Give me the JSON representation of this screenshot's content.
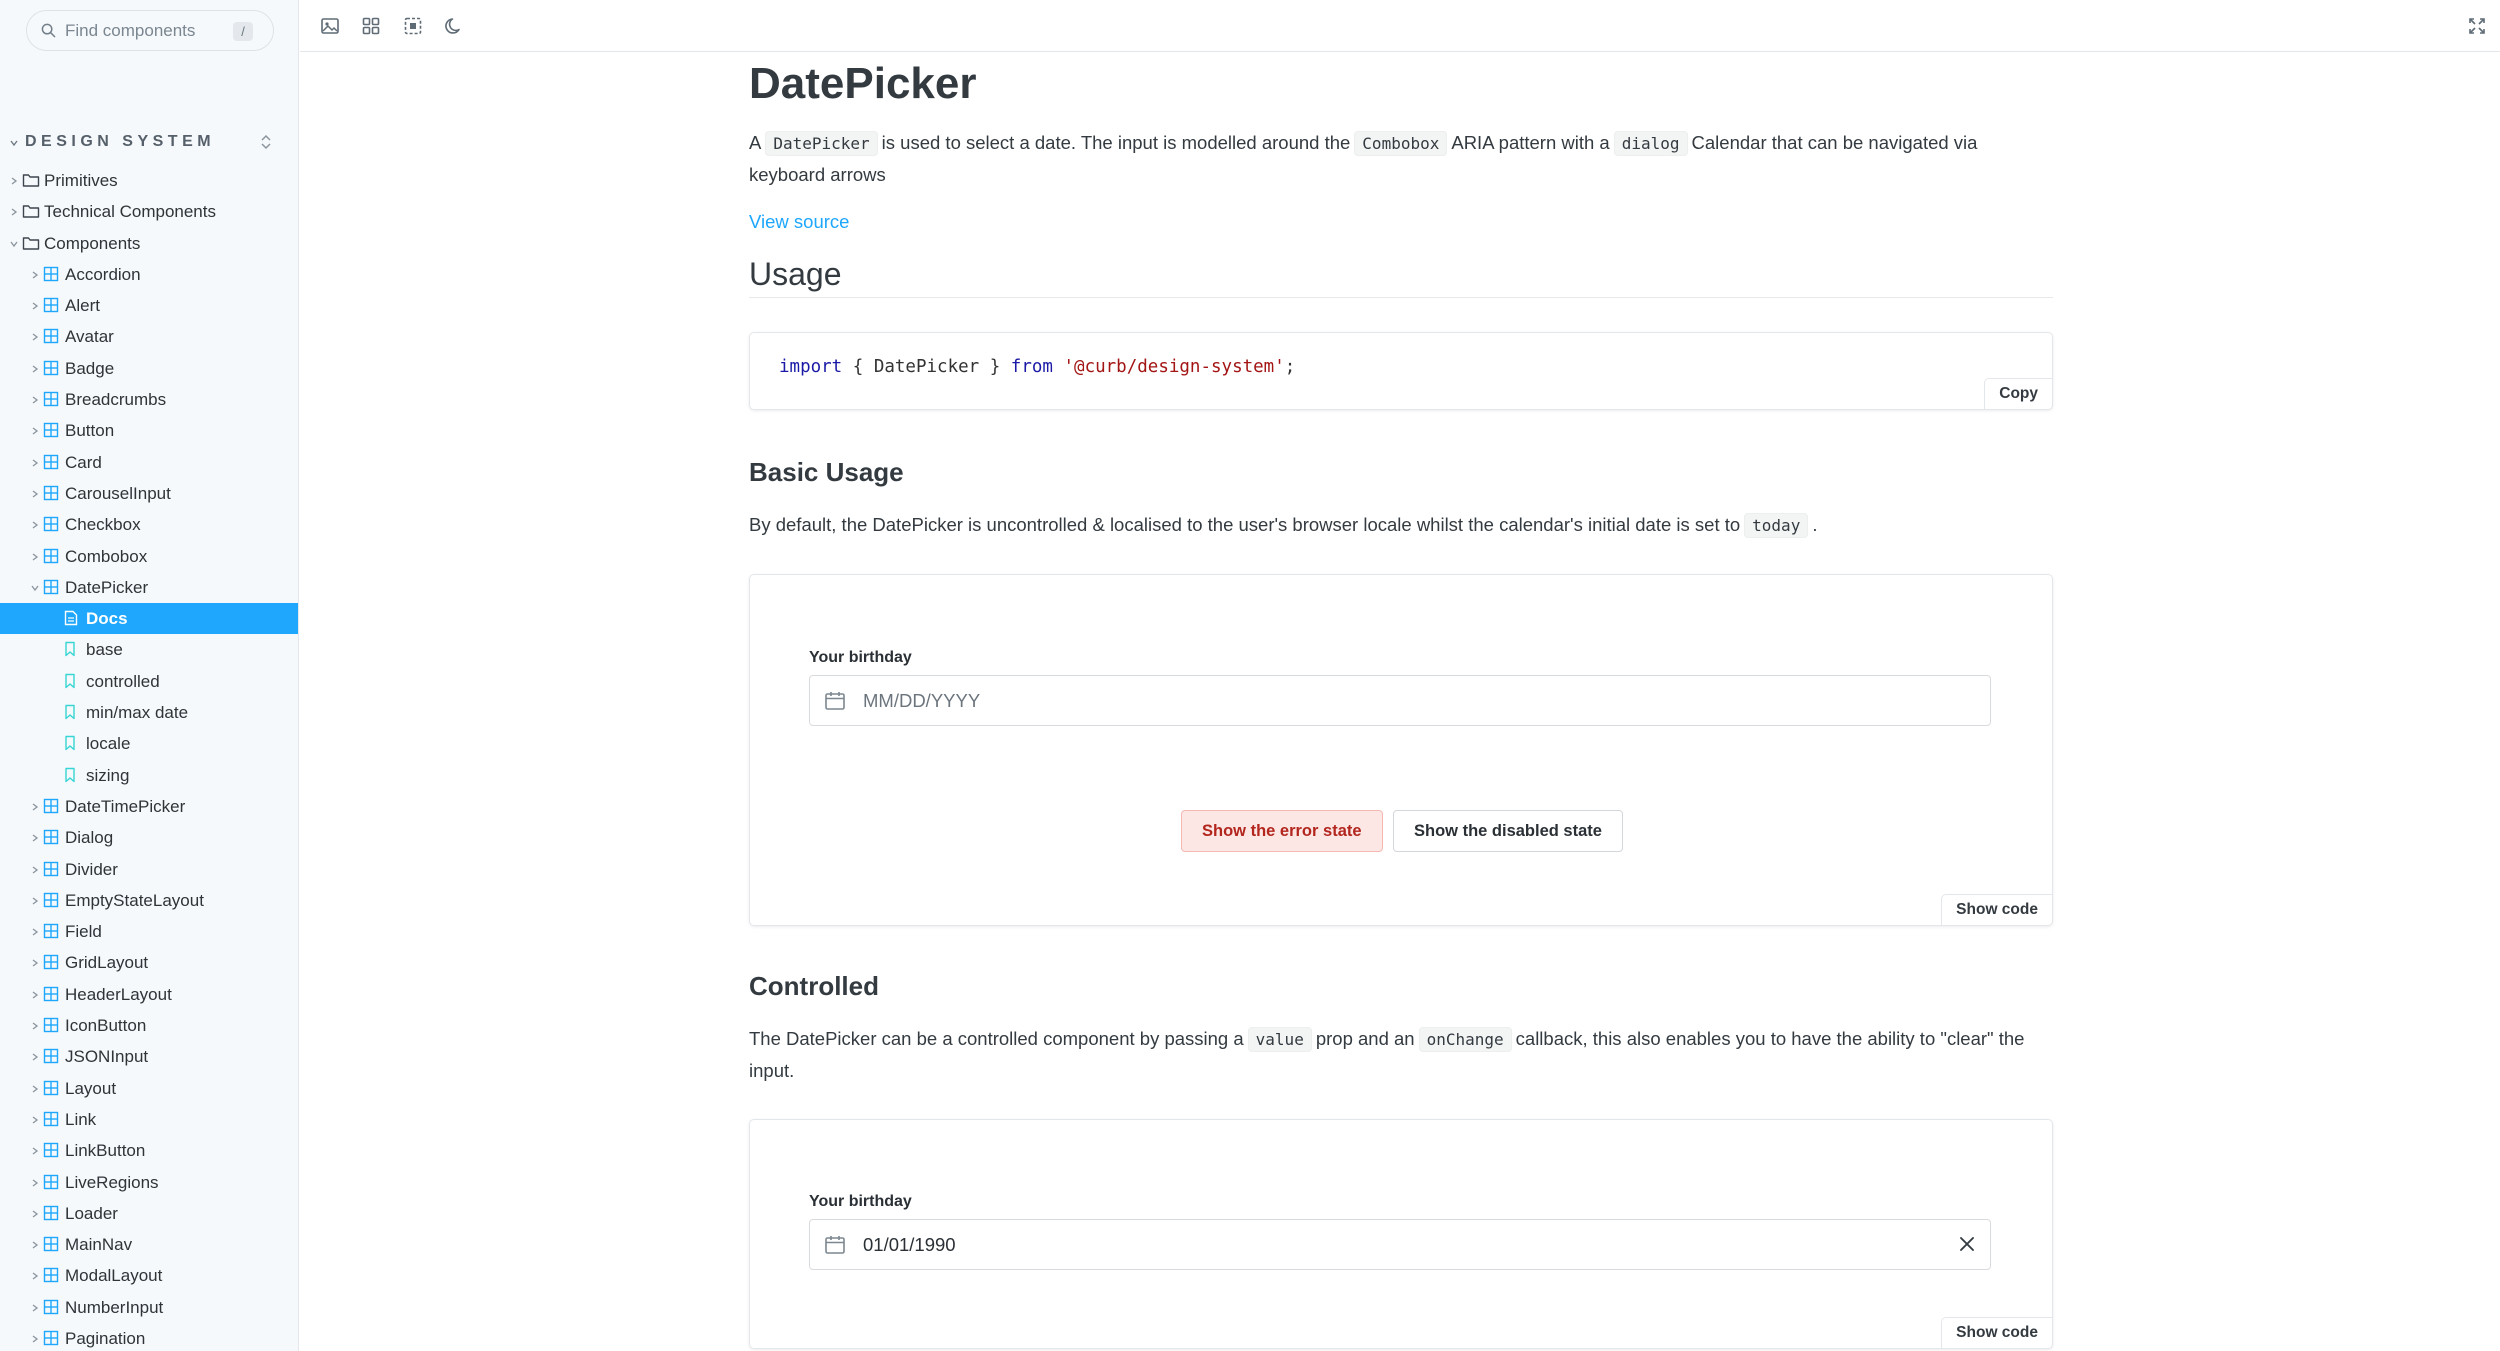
{
  "sidebar": {
    "search_placeholder": "Find components",
    "search_shortcut": "/",
    "section_title": "DESIGN SYSTEM",
    "tree": [
      {
        "label": "Primitives",
        "type": "folder",
        "level": 0,
        "expanded": false
      },
      {
        "label": "Technical Components",
        "type": "folder",
        "level": 0,
        "expanded": false
      },
      {
        "label": "Components",
        "type": "folder",
        "level": 0,
        "expanded": true
      },
      {
        "label": "Accordion",
        "type": "component",
        "level": 1,
        "expanded": false
      },
      {
        "label": "Alert",
        "type": "component",
        "level": 1,
        "expanded": false
      },
      {
        "label": "Avatar",
        "type": "component",
        "level": 1,
        "expanded": false
      },
      {
        "label": "Badge",
        "type": "component",
        "level": 1,
        "expanded": false
      },
      {
        "label": "Breadcrumbs",
        "type": "component",
        "level": 1,
        "expanded": false
      },
      {
        "label": "Button",
        "type": "component",
        "level": 1,
        "expanded": false
      },
      {
        "label": "Card",
        "type": "component",
        "level": 1,
        "expanded": false
      },
      {
        "label": "CarouselInput",
        "type": "component",
        "level": 1,
        "expanded": false
      },
      {
        "label": "Checkbox",
        "type": "component",
        "level": 1,
        "expanded": false
      },
      {
        "label": "Combobox",
        "type": "component",
        "level": 1,
        "expanded": false
      },
      {
        "label": "DatePicker",
        "type": "component",
        "level": 1,
        "expanded": true
      },
      {
        "label": "Docs",
        "type": "doc",
        "level": 2,
        "selected": true
      },
      {
        "label": "base",
        "type": "story",
        "level": 2
      },
      {
        "label": "controlled",
        "type": "story",
        "level": 2
      },
      {
        "label": "min/max date",
        "type": "story",
        "level": 2
      },
      {
        "label": "locale",
        "type": "story",
        "level": 2
      },
      {
        "label": "sizing",
        "type": "story",
        "level": 2
      },
      {
        "label": "DateTimePicker",
        "type": "component",
        "level": 1,
        "expanded": false
      },
      {
        "label": "Dialog",
        "type": "component",
        "level": 1,
        "expanded": false
      },
      {
        "label": "Divider",
        "type": "component",
        "level": 1,
        "expanded": false
      },
      {
        "label": "EmptyStateLayout",
        "type": "component",
        "level": 1,
        "expanded": false
      },
      {
        "label": "Field",
        "type": "component",
        "level": 1,
        "expanded": false
      },
      {
        "label": "GridLayout",
        "type": "component",
        "level": 1,
        "expanded": false
      },
      {
        "label": "HeaderLayout",
        "type": "component",
        "level": 1,
        "expanded": false
      },
      {
        "label": "IconButton",
        "type": "component",
        "level": 1,
        "expanded": false
      },
      {
        "label": "JSONInput",
        "type": "component",
        "level": 1,
        "expanded": false
      },
      {
        "label": "Layout",
        "type": "component",
        "level": 1,
        "expanded": false
      },
      {
        "label": "Link",
        "type": "component",
        "level": 1,
        "expanded": false
      },
      {
        "label": "LinkButton",
        "type": "component",
        "level": 1,
        "expanded": false
      },
      {
        "label": "LiveRegions",
        "type": "component",
        "level": 1,
        "expanded": false
      },
      {
        "label": "Loader",
        "type": "component",
        "level": 1,
        "expanded": false
      },
      {
        "label": "MainNav",
        "type": "component",
        "level": 1,
        "expanded": false
      },
      {
        "label": "ModalLayout",
        "type": "component",
        "level": 1,
        "expanded": false
      },
      {
        "label": "NumberInput",
        "type": "component",
        "level": 1,
        "expanded": false
      },
      {
        "label": "Pagination",
        "type": "component",
        "level": 1,
        "expanded": false
      }
    ]
  },
  "colors": {
    "accent": "#1ea7fd",
    "sidebar_bg": "#f6f9fc",
    "error_bg": "#fde7e5",
    "error_text": "#b3261e"
  },
  "page": {
    "title": "DatePicker",
    "intro": {
      "t1": "A",
      "c1": "DatePicker",
      "t2": "is used to select a date. The input is modelled around the",
      "c2": "Combobox",
      "t3": "ARIA pattern with a",
      "c3": "dialog",
      "t4": "Calendar that can be navigated via",
      "t5": "keyboard arrows"
    },
    "view_source": "View source",
    "usage_heading": "Usage",
    "usage_code": {
      "kw_import": "import",
      "middle": " { DatePicker } ",
      "kw_from": "from",
      "module": "'@curb/design-system'",
      "semi": ";"
    },
    "copy_label": "Copy",
    "basic": {
      "heading": "Basic Usage",
      "t1": "By default, the DatePicker is uncontrolled & localised to the user's browser locale whilst the calendar's initial date is set to",
      "c1": "today",
      "t2": ".",
      "field_label": "Your birthday",
      "placeholder": "MM/DD/YYYY",
      "error_button": "Show the error state",
      "disabled_button": "Show the disabled state",
      "show_code": "Show code"
    },
    "controlled": {
      "heading": "Controlled",
      "t1": "The DatePicker can be a controlled component by passing a",
      "c1": "value",
      "t2": "prop and an",
      "c2": "onChange",
      "t3": "callback, this also enables you to have the ability to \"clear\" the",
      "t4": "input.",
      "field_label": "Your birthday",
      "value": "01/01/1990",
      "show_code": "Show code"
    }
  },
  "toolbar": {
    "buttons": [
      "image-icon",
      "grid-icon",
      "outline-icon",
      "moon-icon"
    ],
    "right": "fullscreen-icon"
  }
}
